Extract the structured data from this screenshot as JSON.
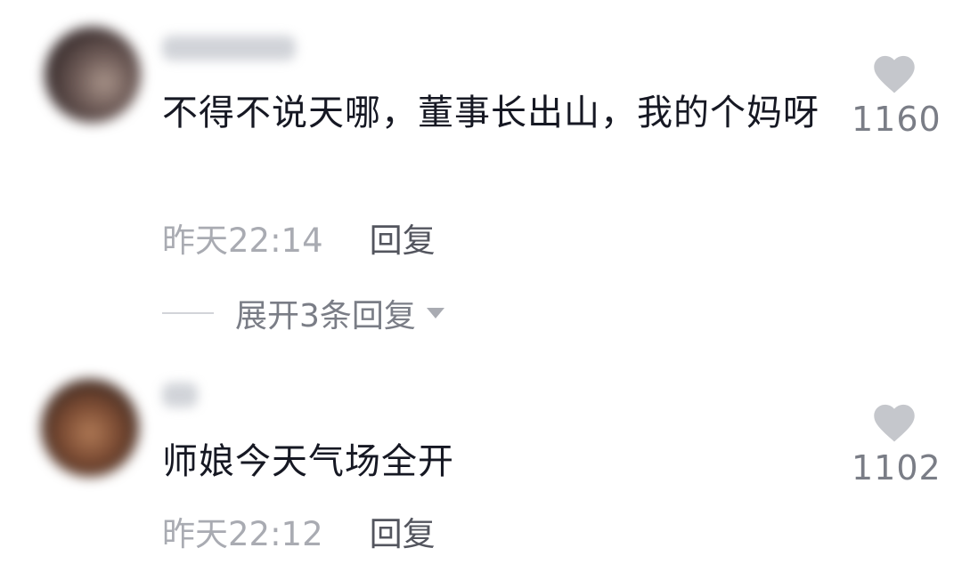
{
  "comments": [
    {
      "text": "不得不说天哪，董事长出山，我的个妈呀",
      "time": "昨天22:14",
      "reply_label": "回复",
      "expand_label": "展开3条回复",
      "like_count": "1160"
    },
    {
      "text": "师娘今天气场全开",
      "time": "昨天22:12",
      "reply_label": "回复",
      "like_count": "1102"
    }
  ],
  "colors": {
    "text": "#161823",
    "meta": "#a9abb2",
    "reply": "#53555e",
    "heart": "#c5c7cc"
  }
}
